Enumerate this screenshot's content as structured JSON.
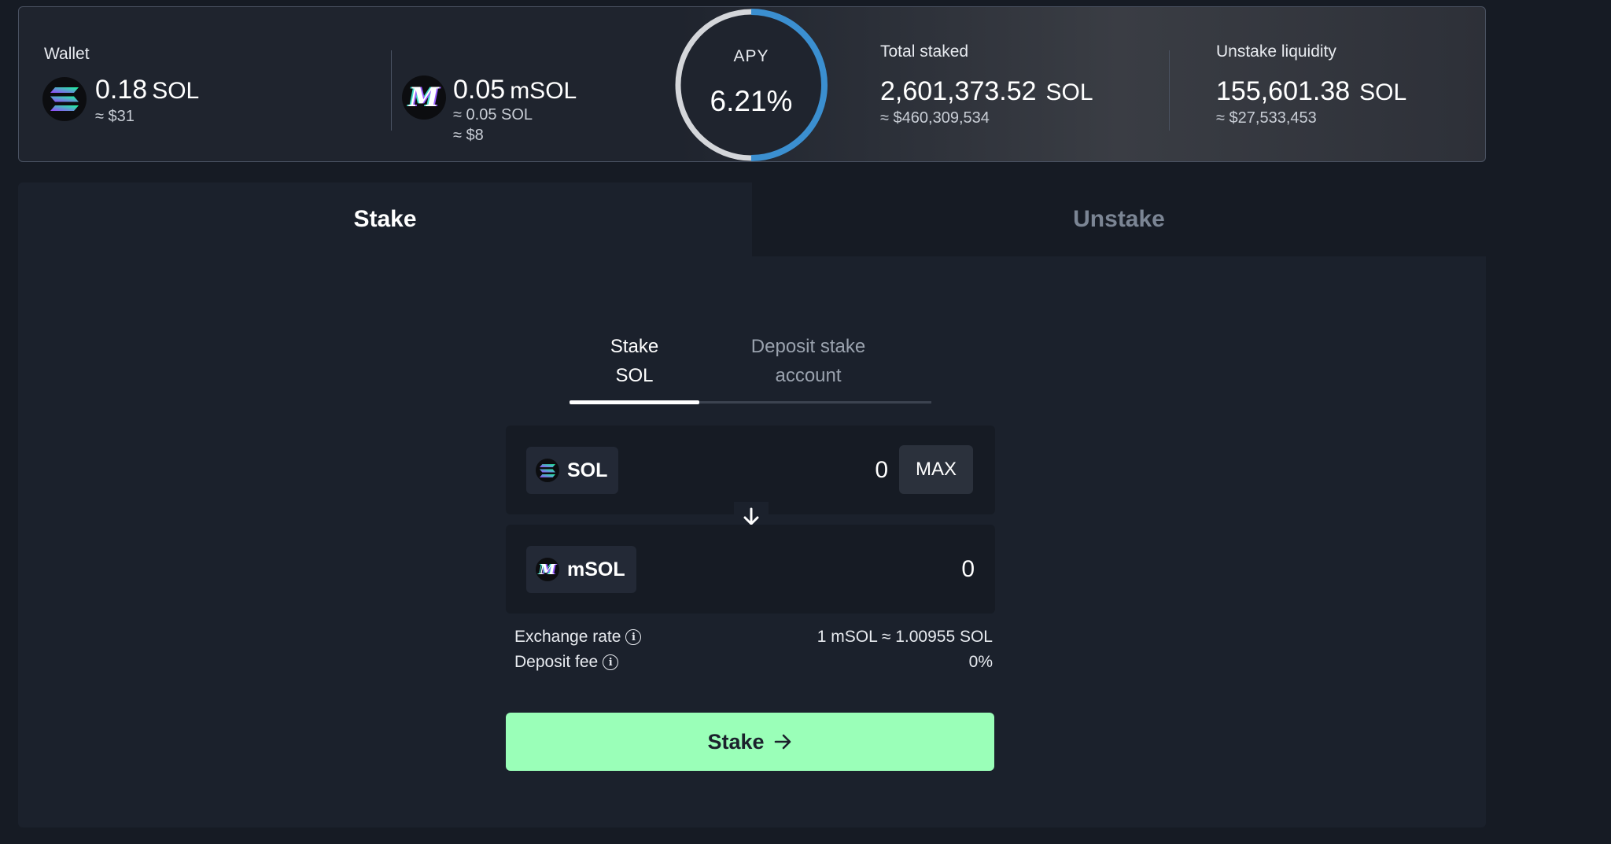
{
  "wallet": {
    "label": "Wallet",
    "sol_amount": "0.18",
    "sol_unit": "SOL",
    "sol_usd": "≈ $31",
    "msol_amount": "0.05",
    "msol_unit": "mSOL",
    "msol_in_sol": "≈ 0.05 SOL",
    "msol_usd": "≈ $8"
  },
  "apy": {
    "label": "APY",
    "value": "6.21%",
    "ring_fill": 0.5
  },
  "total_staked": {
    "label": "Total staked",
    "amount": "2,601,373.52",
    "unit": "SOL",
    "usd": "≈ $460,309,534"
  },
  "unstake_liquidity": {
    "label": "Unstake liquidity",
    "amount": "155,601.38",
    "unit": "SOL",
    "usd": "≈ $27,533,453"
  },
  "tabs": {
    "stake": "Stake",
    "unstake": "Unstake"
  },
  "subtabs": {
    "stake_sol_line1": "Stake",
    "stake_sol_line2": "SOL",
    "deposit_line1": "Deposit stake",
    "deposit_line2": "account"
  },
  "input": {
    "token": "SOL",
    "amount": "0",
    "max_label": "MAX"
  },
  "output": {
    "token": "mSOL",
    "amount": "0"
  },
  "info": {
    "exchange_rate_label": "Exchange rate",
    "exchange_rate_value": "1 mSOL ≈ 1.00955 SOL",
    "deposit_fee_label": "Deposit fee",
    "deposit_fee_value": "0%"
  },
  "action": {
    "stake_label": "Stake"
  },
  "colors": {
    "accent_green": "#9affb8",
    "ring_blue": "#3b8fd0",
    "ring_track": "#d4d6da"
  },
  "icons": {
    "sol": "solana-logo-icon",
    "msol": "msol-logo-icon",
    "swap": "arrow-down-icon",
    "info": "info-icon",
    "submit": "arrow-right-icon"
  }
}
